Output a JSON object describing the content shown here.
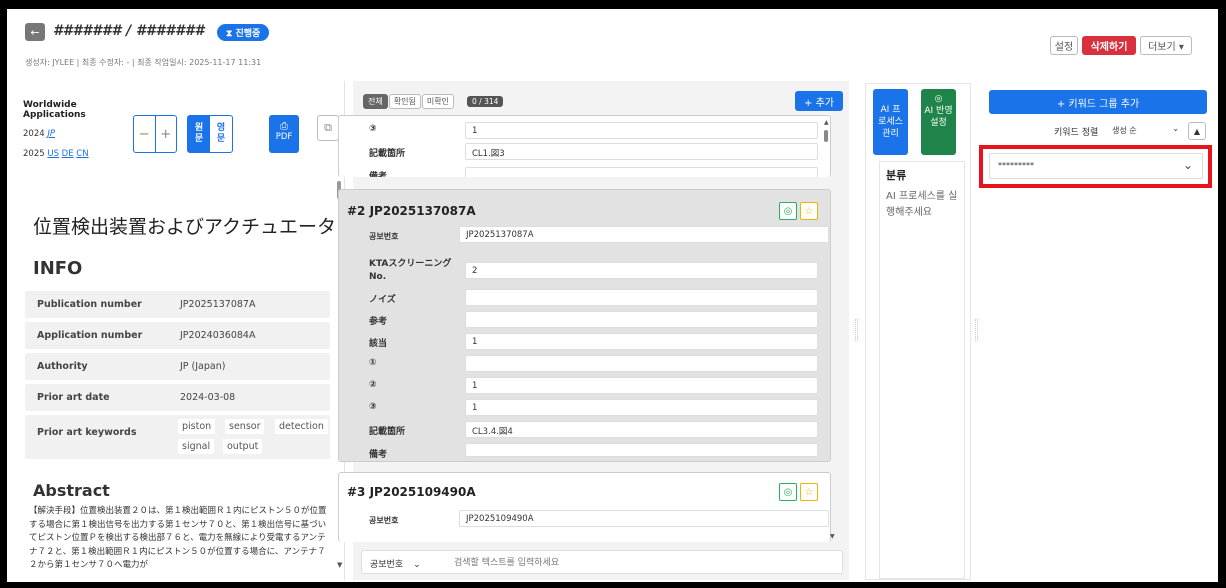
{
  "header": {
    "back_icon": "←",
    "title": "####### / #######",
    "status": "⧗ 진행중",
    "meta": "생성자: JYLEE   |   최종 수정자: -   |   최종 작업일시: 2025-11-17 11:31",
    "settings": "설정",
    "delete": "삭제하기",
    "more": "더보기 ▾"
  },
  "left": {
    "family_title": "Worldwide Applications",
    "family_line1": "2024",
    "family_line1_link": "JP",
    "family_line2": "2025",
    "family_links": [
      "US",
      "DE",
      "CN"
    ],
    "zoom_minus": "−",
    "zoom_plus": "+",
    "orig_label": "원\n문",
    "eng_label": "영\n문",
    "pdf_label": "PDF",
    "title": "位置検出装置およびアクチュエータ",
    "info_heading": "INFO",
    "info": [
      {
        "k": "Publication number",
        "v": "JP2025137087A"
      },
      {
        "k": "Application number",
        "v": "JP2024036084A"
      },
      {
        "k": "Authority",
        "v": "JP (Japan)"
      },
      {
        "k": "Prior art date",
        "v": "2024-03-08"
      },
      {
        "k": "Prior art keywords",
        "v": ""
      }
    ],
    "keywords": [
      "piston",
      "sensor",
      "detection",
      "signal",
      "output"
    ],
    "abstract_heading": "Abstract",
    "abstract": "【解決手段】位置検出装置２０は、第１検出範囲Ｒ１内にピストン５０が位置する場合に第１検出信号を出力する第１センサ７０と、第１検出信号に基づいてピストン位置Ｐを検出する検出部７６と、電力を無線により受電するアンテナ７２と、第１検出範囲Ｒ１内にピストン５０が位置する場合に、アンテナ７２から第１センサ７０へ電力が"
  },
  "middle": {
    "filters": [
      "전체",
      "확인됨",
      "미확인"
    ],
    "count": "0 / 314",
    "add": "+ 추가",
    "top_rows": [
      {
        "k": "③",
        "v": "1"
      },
      {
        "k": "記載箇所",
        "v": "CL1.図3"
      },
      {
        "k": "備考",
        "v": ""
      }
    ],
    "card2": {
      "title": "#2 JP2025137087A",
      "rows": [
        {
          "k": "공보번호",
          "v": "JP2025137087A"
        },
        {
          "k": "KTAスクリーニング No.",
          "v": "2"
        },
        {
          "k": "ノイズ",
          "v": ""
        },
        {
          "k": "参考",
          "v": ""
        },
        {
          "k": "該当",
          "v": "1"
        },
        {
          "k": "①",
          "v": ""
        },
        {
          "k": "②",
          "v": "1"
        },
        {
          "k": "③",
          "v": "1"
        },
        {
          "k": "記載箇所",
          "v": "CL3.4.図4"
        },
        {
          "k": "備考",
          "v": ""
        }
      ]
    },
    "card3": {
      "title": "#3 JP2025109490A",
      "rows": [
        {
          "k": "공보번호",
          "v": "JP2025109490A"
        }
      ]
    },
    "search_select": "공보번호",
    "search_placeholder": "검색할 텍스트를 입력하세요"
  },
  "ai": {
    "process": "AI 프로세스 관리",
    "apply": "AI 반영 설정",
    "classify": "분류",
    "msg": "AI 프로세스를 실행해주세요"
  },
  "right": {
    "add_group": "+ 키워드 그룹 추가",
    "sort_label": "키워드 정렬",
    "sort_value": "생성 순",
    "group_name": "*********"
  }
}
